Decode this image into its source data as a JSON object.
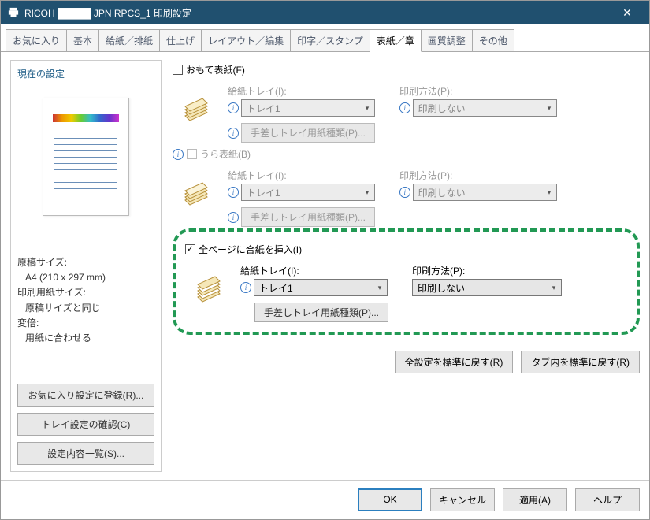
{
  "title": "RICOH █████ JPN RPCS_1 印刷設定",
  "tabs": [
    "お気に入り",
    "基本",
    "給紙／排紙",
    "仕上げ",
    "レイアウト／編集",
    "印字／スタンプ",
    "表紙／章",
    "画質調整",
    "その他"
  ],
  "active_tab": 6,
  "left": {
    "title": "現在の設定",
    "doc_size_label": "原稿サイズ:",
    "doc_size_value": "A4 (210 x 297 mm)",
    "paper_size_label": "印刷用紙サイズ:",
    "paper_size_value": "原稿サイズと同じ",
    "scale_label": "変倍:",
    "scale_value": "用紙に合わせる",
    "buttons": {
      "register": "お気に入り設定に登録(R)...",
      "tray_confirm": "トレイ設定の確認(C)",
      "setting_list": "設定内容一覧(S)..."
    }
  },
  "sections": {
    "front": {
      "label": "おもて表紙(F)",
      "tray_label": "給紙トレイ(I):",
      "tray_value": "トレイ1",
      "method_label": "印刷方法(P):",
      "method_value": "印刷しない",
      "bypass_button": "手差しトレイ用紙種類(P)..."
    },
    "back": {
      "label": "うら表紙(B)",
      "tray_label": "給紙トレイ(I):",
      "tray_value": "トレイ1",
      "method_label": "印刷方法(P):",
      "method_value": "印刷しない",
      "bypass_button": "手差しトレイ用紙種類(P)..."
    },
    "slip": {
      "label": "全ページに合紙を挿入(I)",
      "tray_label": "給紙トレイ(I):",
      "tray_value": "トレイ1",
      "method_label": "印刷方法(P):",
      "method_value": "印刷しない",
      "bypass_button": "手差しトレイ用紙種類(P)..."
    }
  },
  "bottom_buttons": {
    "reset_all": "全設定を標準に戻す(R)",
    "reset_tab": "タブ内を標準に戻す(R)"
  },
  "footer": {
    "ok": "OK",
    "cancel": "キャンセル",
    "apply": "適用(A)",
    "help": "ヘルプ"
  }
}
